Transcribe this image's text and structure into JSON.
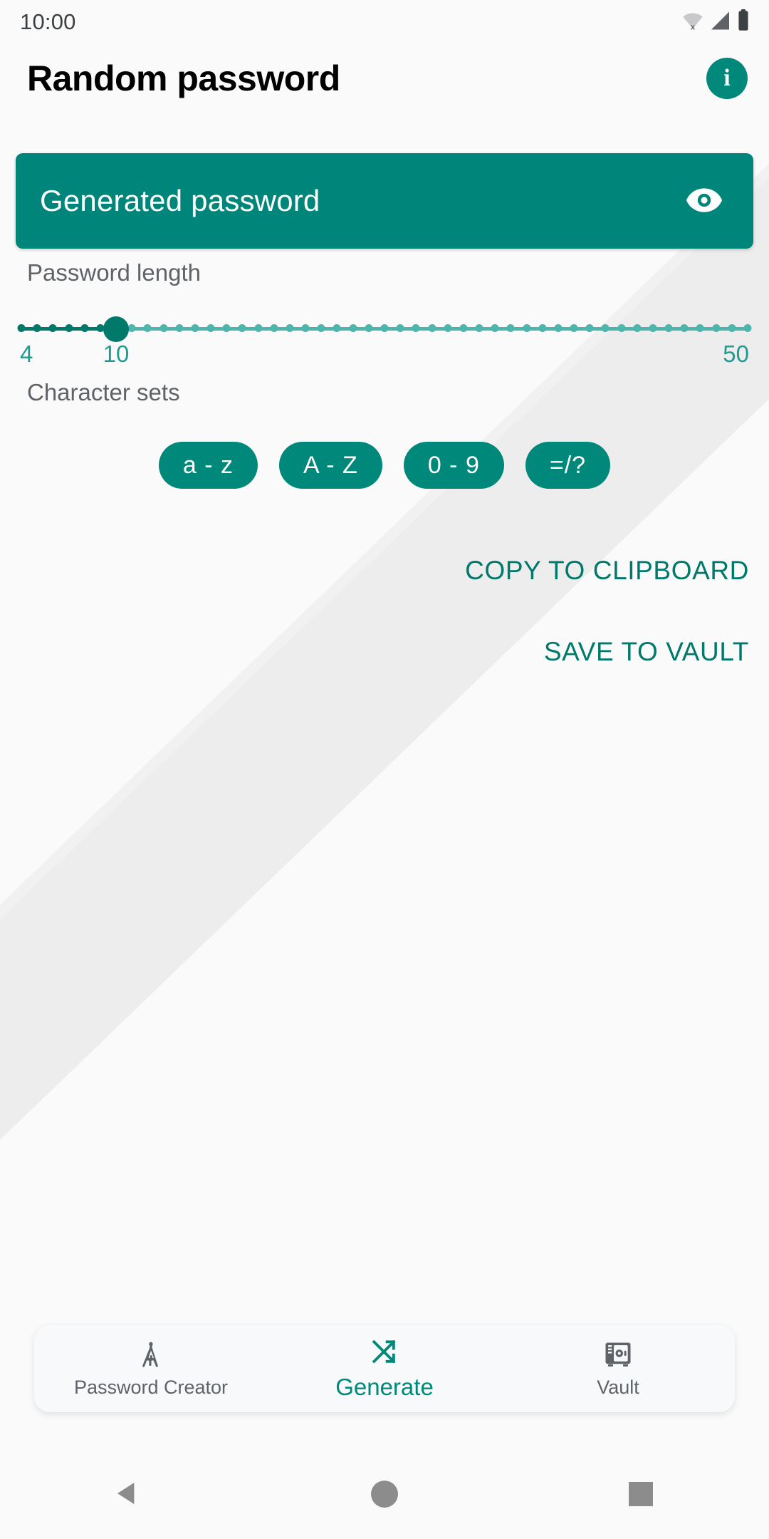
{
  "status_bar": {
    "time": "10:00",
    "icons": [
      "wifi-off-icon",
      "cellular-signal-icon",
      "battery-full-icon"
    ]
  },
  "app_bar": {
    "title": "Random password",
    "info_label": "i",
    "info_icon": "info-icon"
  },
  "password_card": {
    "value": "Generated password",
    "visibility_icon": "eye-icon",
    "background": "#00857a"
  },
  "password_length": {
    "label": "Password length",
    "min": 4,
    "max": 50,
    "value": 10,
    "min_label": "4",
    "max_label": "50",
    "value_label": "10"
  },
  "character_sets": {
    "label": "Character sets",
    "chips": [
      {
        "label": "a - z",
        "selected": true
      },
      {
        "label": "A - Z",
        "selected": true
      },
      {
        "label": "0 - 9",
        "selected": true
      },
      {
        "label": "=/?",
        "selected": true
      }
    ]
  },
  "actions": [
    {
      "label": "COPY TO CLIPBOARD"
    },
    {
      "label": "SAVE TO VAULT"
    }
  ],
  "bottom_nav": {
    "items": [
      {
        "label": "Password Creator",
        "icon": "compass-drafting-icon",
        "active": false
      },
      {
        "label": "Generate",
        "icon": "shuffle-icon",
        "active": true
      },
      {
        "label": "Vault",
        "icon": "safe-icon",
        "active": false
      }
    ]
  },
  "system_nav": {
    "back_icon": "triangle-back-icon",
    "home_icon": "circle-home-icon",
    "recents_icon": "square-recents-icon"
  },
  "colors": {
    "accent": "#00897b",
    "accent_dark": "#00796b",
    "accent_card": "#00857a",
    "accent_light": "#4db6ac",
    "link": "#00796b",
    "background": "#fafafa",
    "decor": "#ececec",
    "text_secondary": "#5f6368"
  }
}
